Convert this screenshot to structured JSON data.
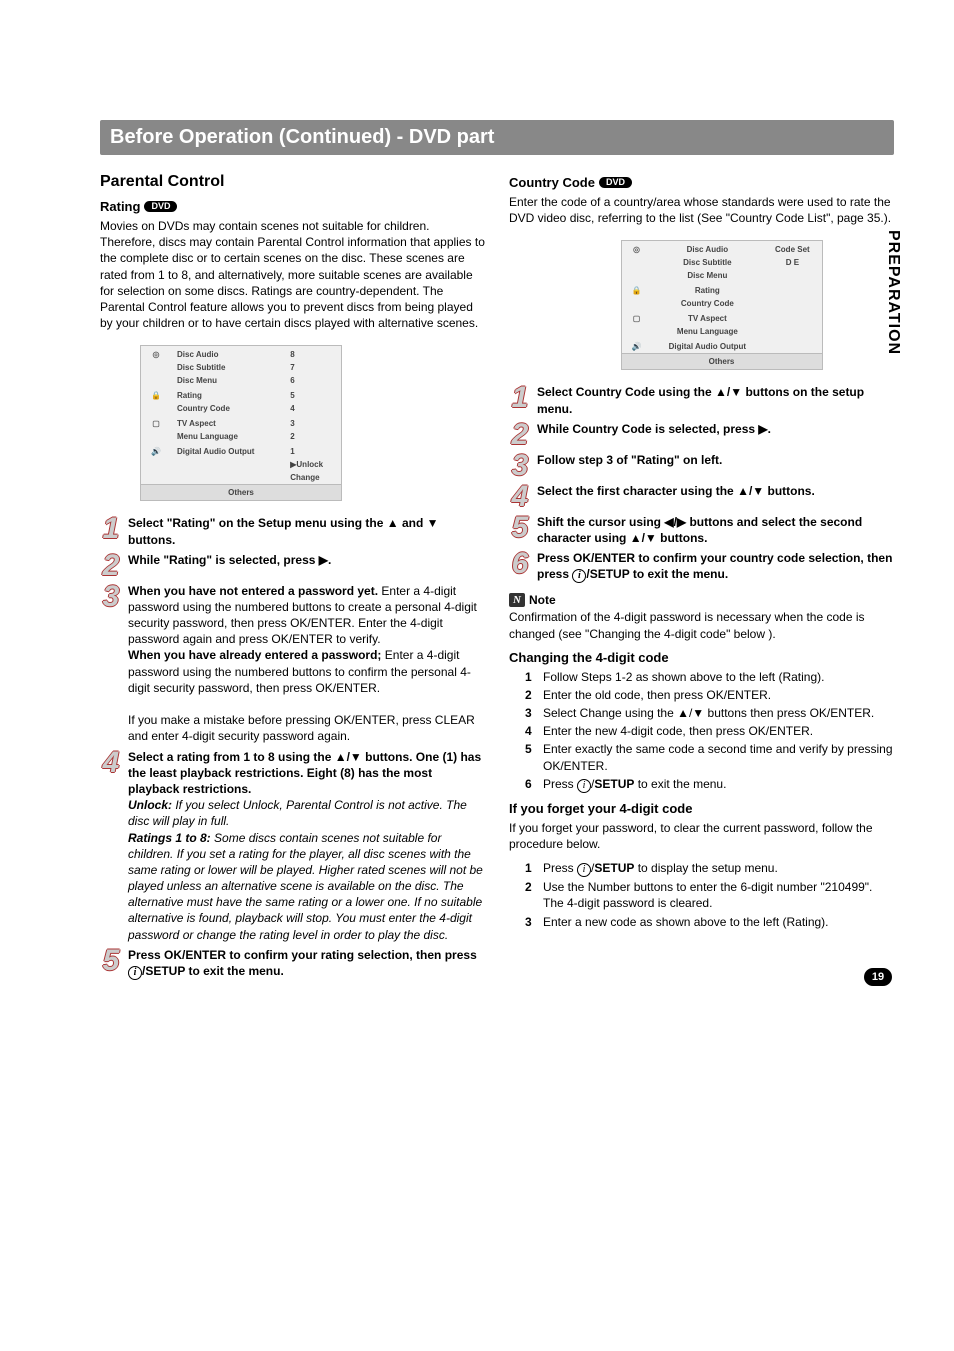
{
  "side_tab": "PREPARATION",
  "header": "Before Operation (Continued) - DVD part",
  "page_number": "19",
  "dvd_label": "DVD",
  "left": {
    "h2": "Parental Control",
    "rating_label": "Rating",
    "rating_body": "Movies on DVDs may contain scenes not suitable for children. Therefore, discs may contain Parental Control information that applies to the complete disc or to certain scenes on the disc. These scenes are rated from 1 to 8, and alternatively, more suitable scenes are available for selection on some discs. Ratings are country-dependent. The Parental Control feature allows you to prevent discs from being played by your children or to have certain discs played with alternative scenes.",
    "menu": {
      "group1": [
        "Disc Audio",
        "Disc Subtitle",
        "Disc Menu"
      ],
      "group2": [
        "Rating",
        "Country Code"
      ],
      "group3": [
        "TV Aspect",
        "Menu Language"
      ],
      "group4": [
        "Digital Audio Output"
      ],
      "right": [
        "8",
        "7",
        "6",
        "5",
        "4",
        "3",
        "2",
        "1",
        "▶Unlock",
        "Change"
      ],
      "others": "Others"
    },
    "steps": {
      "1": "Select \"Rating\" on the Setup menu using the ▲ and ▼ buttons.",
      "2": "While \"Rating\" is selected, press ▶.",
      "3_title": "When you have not entered a password yet.",
      "3_body1": "Enter a 4-digit password using the numbered buttons to create a personal 4-digit security password, then press OK/ENTER. Enter the 4-digit password again and press OK/ENTER to verify.",
      "3_title2": "When you have already entered a password;",
      "3_body2": "Enter a 4-digit password using the numbered buttons to confirm the personal 4-digit security password, then press OK/ENTER.",
      "3_note": "If you make a mistake before pressing OK/ENTER, press CLEAR and enter 4-digit security password again.",
      "4_bold": "Select a rating from 1 to 8 using the ▲/▼ buttons. One (1) has the least playback restrictions. Eight (8) has the most playback restrictions.",
      "4_unlock_label": "Unlock:",
      "4_unlock_body": " If you select Unlock, Parental Control is not active. The disc will play in full.",
      "4_ratings_label": "Ratings 1 to 8:",
      "4_ratings_body": " Some discs contain scenes not suitable for children. If you set a rating for the player, all disc scenes with the same rating or lower will be played. Higher rated scenes will not be played unless an alternative scene is available on the disc. The alternative must have the same rating or a lower one. If no suitable alternative is found, playback will stop. You must enter the 4-digit password or change the rating level in order to play the disc.",
      "5_a": "Press OK/ENTER to confirm your rating selection, then press ",
      "5_b": "/SETUP to exit the menu."
    }
  },
  "right": {
    "cc_label": "Country Code",
    "cc_body": "Enter the code of a country/area whose standards were used to rate the DVD video disc, referring to the list (See \"Country Code List\", page 35.).",
    "menu": {
      "group1": [
        "Disc Audio",
        "Disc Subtitle",
        "Disc Menu"
      ],
      "group2": [
        "Rating",
        "Country Code"
      ],
      "group3": [
        "TV Aspect",
        "Menu Language"
      ],
      "group4": [
        "Digital Audio Output"
      ],
      "code_set": "Code Set",
      "code_val": "D E",
      "others": "Others"
    },
    "steps": {
      "1": "Select Country Code using the ▲/▼ buttons on the setup menu.",
      "2": "While Country Code is selected, press ▶.",
      "3": "Follow step 3 of \"Rating\" on left.",
      "4": "Select the first character using the ▲/▼ buttons.",
      "5": "Shift the cursor using ◀/▶ buttons and select the second character using ▲/▼ buttons.",
      "6_a": "Press OK/ENTER to confirm your country code selection, then press ",
      "6_b": "/SETUP to exit the menu."
    },
    "note_label": "Note",
    "note_body": "Confirmation of the 4-digit password is necessary when the code is changed (see \"Changing the 4-digit code\" below ).",
    "change_h": "Changing the 4-digit code",
    "change": {
      "1": "Follow Steps 1-2 as shown above to the left (Rating).",
      "2": "Enter the old code, then press OK/ENTER.",
      "3": "Select Change using the ▲/▼ buttons then press OK/ENTER.",
      "4": "Enter the new 4-digit code, then press OK/ENTER.",
      "5": "Enter exactly the same code a second time and verify by pressing OK/ENTER.",
      "6_a": "Press ",
      "6_b": "/",
      "6_c": "SETUP",
      "6_d": " to exit the menu."
    },
    "forget_h": "If you forget your 4-digit code",
    "forget_body": "If you forget your password, to clear the current password, follow the procedure below.",
    "forget": {
      "1_a": "Press ",
      "1_b": "/",
      "1_c": "SETUP",
      "1_d": " to display the setup menu.",
      "2": "Use the Number buttons to enter the 6-digit number \"210499\".",
      "2b": "The 4-digit password is cleared.",
      "3": "Enter a new code as shown above to the left (Rating)."
    }
  }
}
